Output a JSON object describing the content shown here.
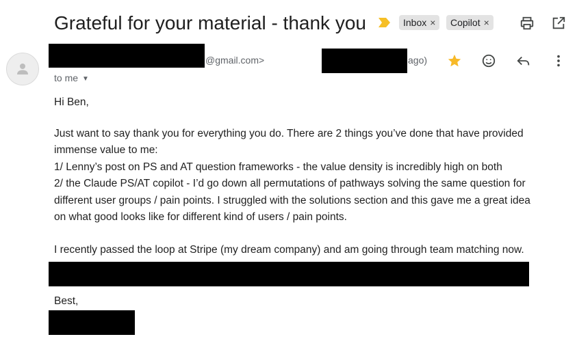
{
  "email": {
    "subject": "Grateful for your material - thank you",
    "labels": [
      {
        "name": "Inbox",
        "remove": "×"
      },
      {
        "name": "Copilot",
        "remove": "×"
      }
    ],
    "sender": {
      "email_domain": "@gmail.com>",
      "date_suffix": "ago)"
    },
    "recipient_line": "to me",
    "body": {
      "greeting": "Hi Ben,",
      "paragraph_lines": [
        "Just want to say thank you for everything you do. There are 2 things you’ve done that have provided",
        "immense value to me:",
        "1/ Lenny’s post on PS and AT question frameworks - the value density is incredibly high on both",
        "2/ the Claude PS/AT copilot - I’d go down all permutations of pathways solving the same question for",
        "different user groups / pain points. I struggled with the solutions section and this gave me a great idea",
        "on what good looks like for different kind of users / pain points."
      ],
      "closing_paragraph": "I recently passed the loop at Stripe (my dream company) and am going through team matching now.",
      "signoff": "Best,"
    }
  },
  "icons": {
    "importance_marker": "importance-marker-icon",
    "print": "print-icon",
    "new_window": "open-in-new-window-icon",
    "avatar": "person-avatar-icon",
    "star": "star-icon",
    "emoji": "emoji-reaction-icon",
    "reply": "reply-icon",
    "more": "more-vertical-icon",
    "expand_recipients": "caret-down-icon"
  },
  "colors": {
    "star": "#f7b928",
    "importance": "#f6bf26",
    "chip_bg": "#e3e3e3",
    "secondary_text": "#5f6368"
  }
}
